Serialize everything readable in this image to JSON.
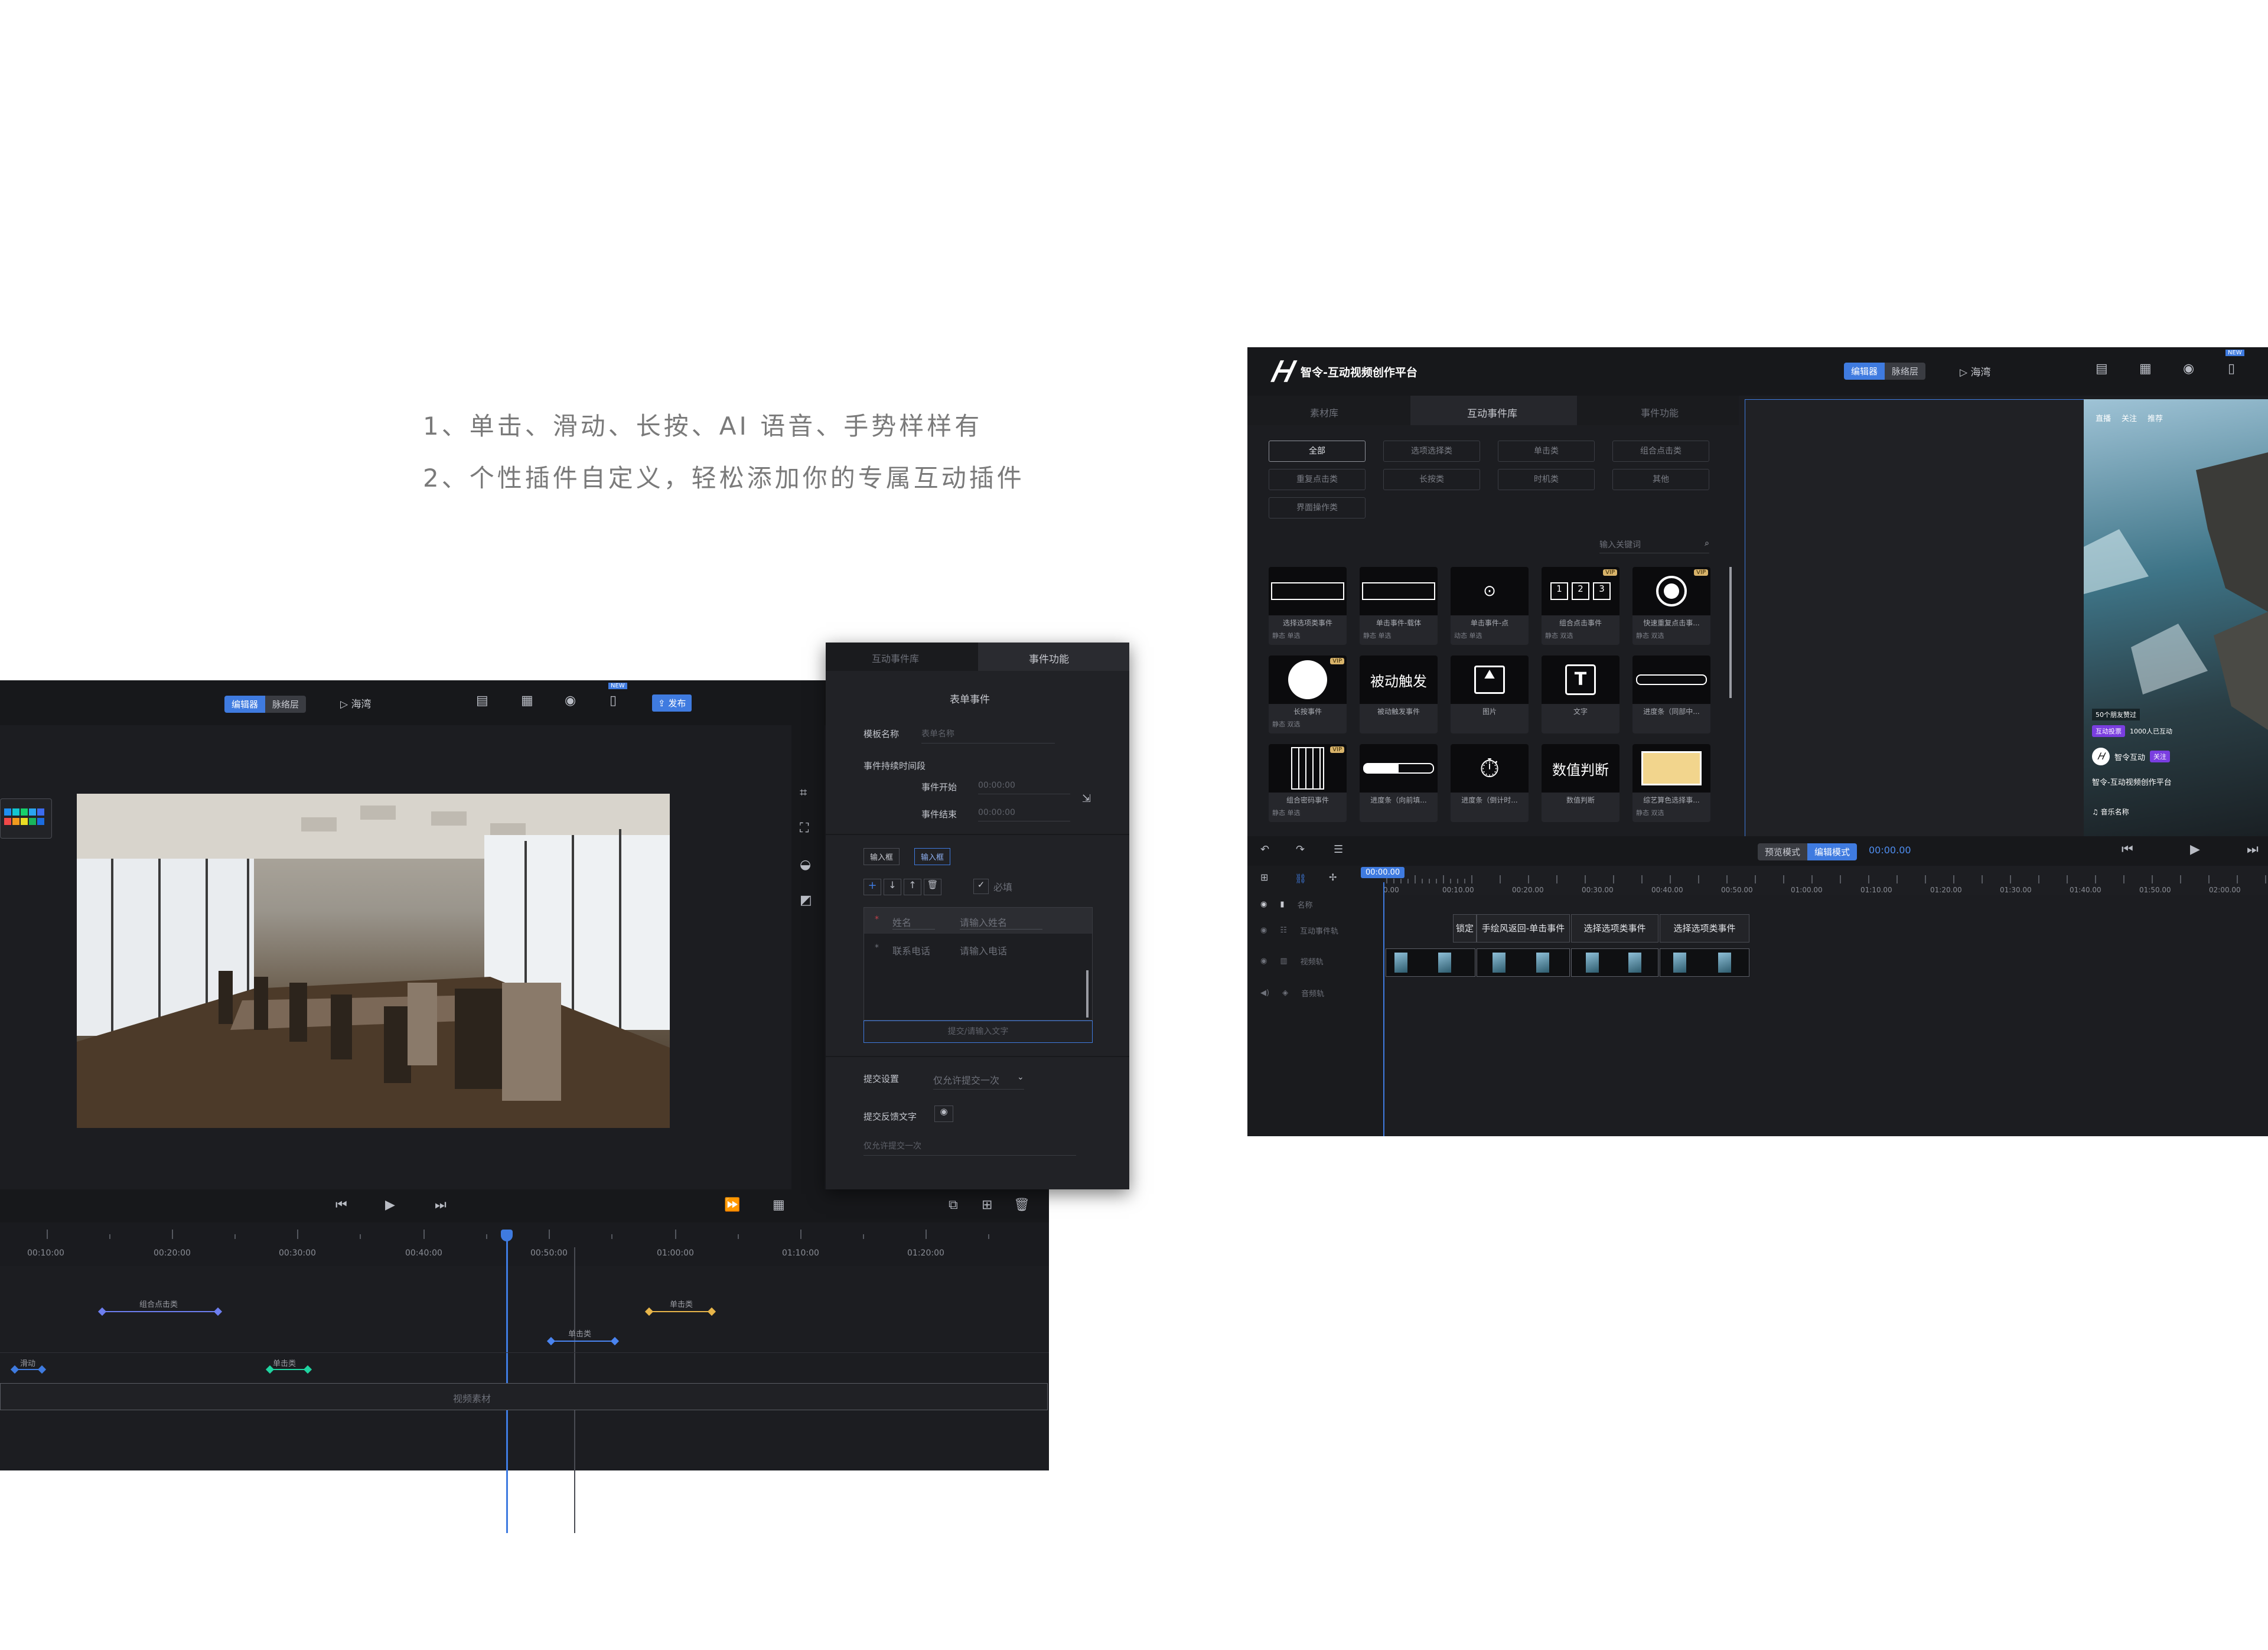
{
  "intro": {
    "line1": "1、单击、滑动、长按、AI 语音、手势样样有",
    "line2": "2、个性插件自定义，轻松添加你的专属互动插件"
  },
  "left_editor": {
    "mode_tabs": [
      "编辑器",
      "脉络层"
    ],
    "preview_label": "海湾",
    "new_badge": "NEW",
    "publish": "发布",
    "ticks": [
      "00:10:00",
      "00:20:00",
      "00:30:00",
      "00:40:00",
      "00:50:00",
      "01:00:00",
      "01:10:00",
      "01:20:00"
    ],
    "keyframes": {
      "combo": "组合点击类",
      "click_a": "单击类",
      "click_b": "单击类",
      "swipe": "滑动",
      "click_c": "单击类"
    },
    "video_track": "视频素材"
  },
  "form_panel": {
    "tabs": [
      "互动事件库",
      "事件功能"
    ],
    "title": "表单事件",
    "template_name_label": "模板名称",
    "template_name_ph": "表单名称",
    "duration_label": "事件持续时间段",
    "start_label": "事件开始",
    "start_value": "00:00:00",
    "end_label": "事件结束",
    "end_value": "00:00:00",
    "field_types": [
      "输入框",
      "输入框"
    ],
    "required": "必填",
    "rows": [
      {
        "label": "姓名",
        "ph": "请输入姓名"
      },
      {
        "label": "联系电话",
        "ph": "请输入电话"
      }
    ],
    "submit_ph": "提交/请输入文字",
    "submit_settings_label": "提交设置",
    "submit_settings_value": "仅允许提交一次",
    "feedback_label": "提交反馈文字",
    "feedback_ph": "仅允许提交一次"
  },
  "right_app": {
    "title": "智令-互动视频创作平台",
    "mode_tabs": [
      "编辑器",
      "脉络层"
    ],
    "preview_label": "海湾",
    "new_badge": "NEW",
    "panel_tabs": [
      "素材库",
      "互动事件库",
      "事件功能"
    ],
    "filters": [
      "全部",
      "选项选择类",
      "单击类",
      "组合点击类",
      "重复点击类",
      "长按类",
      "时机类",
      "其他",
      "界面操作类"
    ],
    "search_ph": "输入关键词",
    "tiles": [
      {
        "name": "选择选项类事件",
        "meta": "静态  单选",
        "vip": ""
      },
      {
        "name": "单击事件-载体",
        "meta": "静态  单选",
        "vip": ""
      },
      {
        "name": "单击事件-点",
        "meta": "动态  单选",
        "vip": ""
      },
      {
        "name": "组合点击事件",
        "meta": "静态  双选",
        "vip": "VIP"
      },
      {
        "name": "快速重复点击事...",
        "meta": "静态  双选",
        "vip": "VIP"
      },
      {
        "name": "长按事件",
        "meta": "静态  双选",
        "vip": "VIP"
      },
      {
        "name": "被动触发事件",
        "meta": "",
        "vip": ""
      },
      {
        "name": "图片",
        "meta": "",
        "vip": ""
      },
      {
        "name": "文字",
        "meta": "",
        "vip": ""
      },
      {
        "name": "进度条（同部中...",
        "meta": "",
        "vip": ""
      },
      {
        "name": "组合密码事件",
        "meta": "静态  单选",
        "vip": "VIP"
      },
      {
        "name": "进度条（向前填...",
        "meta": "",
        "vip": ""
      },
      {
        "name": "进度条（倒计时...",
        "meta": "",
        "vip": ""
      },
      {
        "name": "数值判断",
        "meta": "",
        "vip": ""
      },
      {
        "name": "综艺算色选择事...",
        "meta": "静态  双选",
        "vip": ""
      }
    ],
    "tile_text": {
      "passive": "被动触发",
      "value": "数值判断",
      "seq": [
        "1",
        "2",
        "3"
      ],
      "text": "T"
    },
    "phone": {
      "tabs": [
        "直播",
        "关注",
        "推荐"
      ],
      "friends": "50个朋友赞过",
      "badge": "互动投票",
      "count": "1000人已互动",
      "account": "智令互动",
      "follow": "关注",
      "caption": "智令-互动视频创作平台",
      "music": "♫ 音乐名称"
    },
    "modes": [
      "预览模式",
      "编辑模式"
    ],
    "time": "00:00.00",
    "playhead": "00:00.00",
    "tracks": [
      "名称",
      "互动事件轨",
      "视频轨",
      "音频轨"
    ],
    "ruler": [
      "0.00",
      "00:10.00",
      "00:20.00",
      "00:30.00",
      "00:40.00",
      "00:50.00",
      "01:00.00",
      "01:10.00",
      "01:20.00",
      "01:30.00",
      "01:40.00",
      "01:50.00",
      "02:00.00"
    ],
    "clips": [
      "锁定",
      "手绘风返回-单击事件",
      "选择选项类事件",
      "选择选项类事件"
    ]
  }
}
